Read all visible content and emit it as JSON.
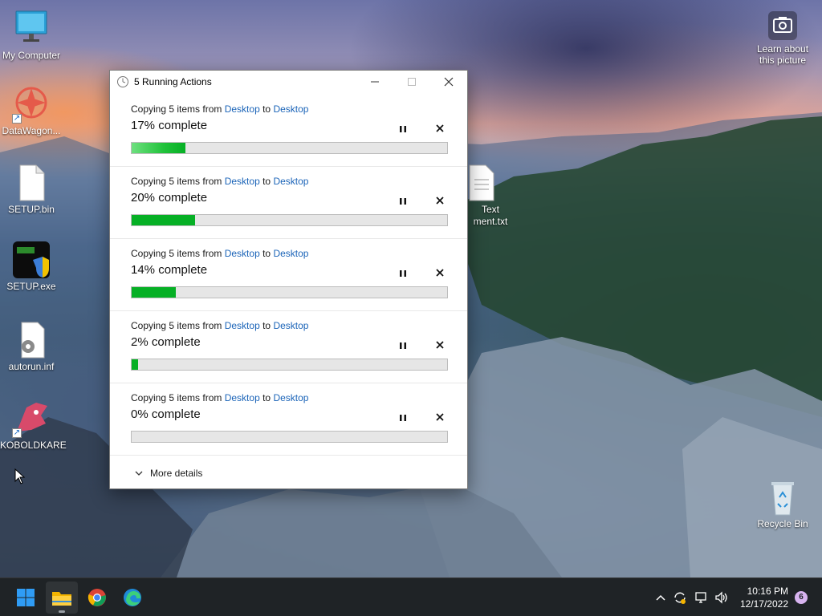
{
  "desktop": {
    "icons": [
      {
        "label": "My Computer"
      },
      {
        "label": "DataWagon..."
      },
      {
        "label": "SETUP.bin"
      },
      {
        "label": "SETUP.exe"
      },
      {
        "label": "autorun.inf"
      },
      {
        "label": "KOBOLDKARE"
      },
      {
        "label": "Learn about this picture"
      },
      {
        "label": "Recycle Bin"
      },
      {
        "label_line1": "Text",
        "label_line2": "ment.txt"
      }
    ]
  },
  "dialog": {
    "title": "5 Running Actions",
    "operations": [
      {
        "prefix": "Copying 5 items from ",
        "source": "Desktop",
        "middle": " to ",
        "destination": "Desktop",
        "progress_text": "17% complete",
        "progress": 17
      },
      {
        "prefix": "Copying 5 items from ",
        "source": "Desktop",
        "middle": " to ",
        "destination": "Desktop",
        "progress_text": "20% complete",
        "progress": 20
      },
      {
        "prefix": "Copying 5 items from ",
        "source": "Desktop",
        "middle": " to ",
        "destination": "Desktop",
        "progress_text": "14% complete",
        "progress": 14
      },
      {
        "prefix": "Copying 5 items from ",
        "source": "Desktop",
        "middle": " to ",
        "destination": "Desktop",
        "progress_text": "2% complete",
        "progress": 2
      },
      {
        "prefix": "Copying 5 items from ",
        "source": "Desktop",
        "middle": " to ",
        "destination": "Desktop",
        "progress_text": "0% complete",
        "progress": 0
      }
    ],
    "more_details": "More details"
  },
  "taskbar": {
    "pinned": [
      "start-icon",
      "file-explorer-icon",
      "chrome-icon",
      "edge-icon"
    ],
    "tray": [
      "chevron-up-icon",
      "sync-icon",
      "network-icon",
      "volume-icon"
    ],
    "time": "10:16 PM",
    "date": "12/17/2022",
    "notification_count": "6"
  },
  "colors": {
    "progress_green": "#06b025",
    "link_blue": "#1b64b8",
    "taskbar_bg": "#1f2326"
  }
}
